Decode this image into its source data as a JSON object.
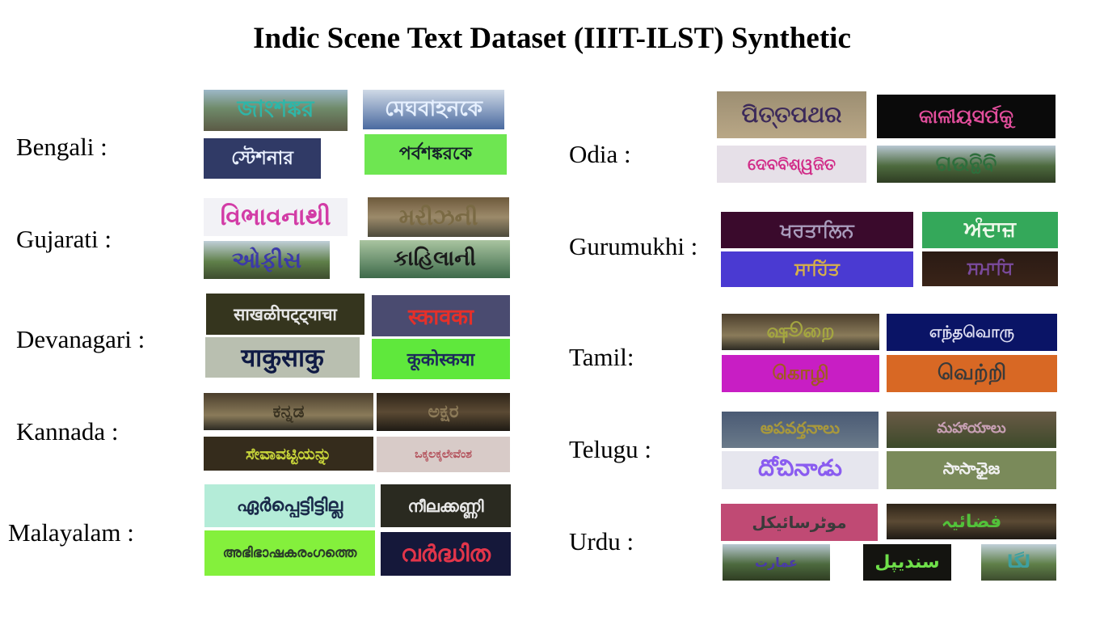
{
  "title": "Indic Scene Text Dataset (IIIT-ILST) Synthetic",
  "languages": [
    {
      "label": "Bengali :",
      "samples": [
        "জাংশঙ্কর",
        "মেঘবাহনকে",
        "স্টেশনার",
        "পর্বশঙ্করকে"
      ]
    },
    {
      "label": "Gujarati :",
      "samples": [
        "વિભાવનાથી",
        "મરીઝની",
        "ઓફીસ",
        "કાહિલાની"
      ]
    },
    {
      "label": "Devanagari :",
      "samples": [
        "साखळीपट्ट्याचा",
        "स्कावका",
        "याकुसाकु",
        "कूकोस्कया"
      ]
    },
    {
      "label": "Kannada :",
      "samples": [
        "ಕನ್ನಡ",
        "ಅಕ್ಷರ",
        "ಸೇವಾವಟ್ಟಿಯನ್ನು",
        "ಒಕ್ಕಲಕ್ಕಲೇವೆಂಶ"
      ]
    },
    {
      "label": "Malayalam :",
      "samples": [
        "ഏർപ്പെട്ടിട്ടില്ല",
        "നീലക്കണ്ണി",
        "അഭിഭാഷകരംഗത്തെ",
        "വർദ്ധിത"
      ]
    },
    {
      "label": "Odia :",
      "samples": [
        "ପିତ୍ତପଥର",
        "କାଳୀୟସର୍ପକୁ",
        "ଦେବବିଶ୍ୱଜିତ",
        "ଗଉନ୍ଥିବି"
      ]
    },
    {
      "label": "Gurumukhi :",
      "samples": [
        "ਖਰਤਾਲਿਨ",
        "ਅੰਦਾਜ਼",
        "ਸਾਹਿੱਤ",
        "ਸਮਾਧਿ"
      ]
    },
    {
      "label": "Tamil:",
      "samples": [
        "ஷூறை",
        "எந்தவொரு",
        "கொழி",
        "வெற்றி"
      ]
    },
    {
      "label": "Telugu :",
      "samples": [
        "అపవర్తనాలు",
        "మహాయాలు",
        "దోచినాడు",
        "సాసాఛైజ"
      ]
    },
    {
      "label": "Urdu :",
      "samples": [
        "موٹرسائیکل",
        "فضائیہ",
        "عمارت",
        "سندیپل",
        "لگا"
      ]
    }
  ],
  "colors": {
    "title": "#000000",
    "background": "#ffffff"
  }
}
